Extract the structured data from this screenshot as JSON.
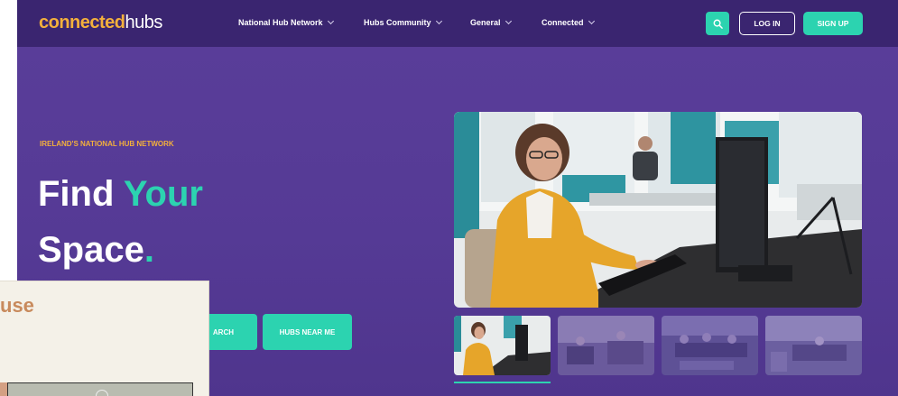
{
  "site": {
    "logo": {
      "part1": "connected",
      "part2": "hubs"
    },
    "nav": {
      "items": [
        {
          "label": "National Hub Network"
        },
        {
          "label": "Hubs Community"
        },
        {
          "label": "General"
        },
        {
          "label": "Connected"
        }
      ],
      "login_label": "LOG IN",
      "signup_label": "SIGN UP"
    },
    "hero": {
      "eyebrow": "IRELAND'S NATIONAL HUB NETWORK",
      "headline_line1_a": "Find",
      "headline_line1_b": "Your",
      "headline_line2": "Space",
      "headline_dot": ".",
      "search_button_label": "ARCH",
      "near_button_label": "HUBS NEAR ME"
    },
    "colors": {
      "accent": "#2cd3b0",
      "brand_orange": "#f3b03c",
      "background": "#553a95",
      "navbar": "#3a2570"
    }
  },
  "overlay": {
    "text": "use"
  }
}
